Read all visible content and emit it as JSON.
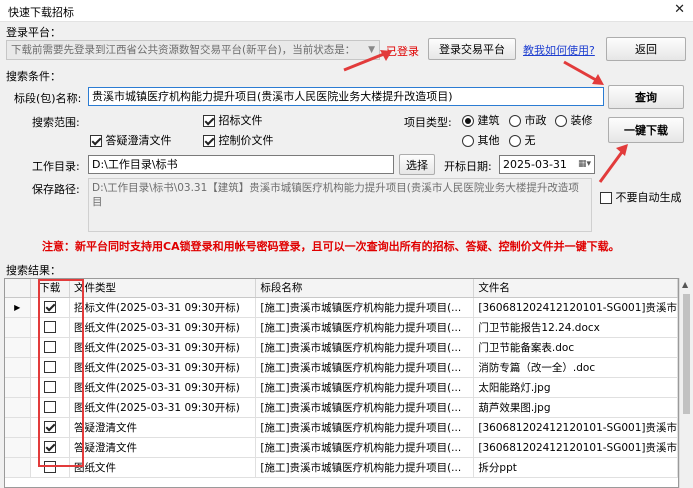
{
  "window": {
    "title": "快速下载招标"
  },
  "login": {
    "section_label": "登录平台：",
    "platform_text": "下载前需要先登录到江西省公共资源数智交易平台(新平台)，当前状态是：",
    "status": "已登录",
    "login_button": "登录交易平台",
    "help_link": "教我如何使用?",
    "back_button": "返回"
  },
  "search": {
    "section_label": "搜索条件：",
    "name_label": "标段(包)名称:",
    "name_value": "贵溪市城镇医疗机构能力提升项目(贵溪市人民医院业务大楼提升改造项目)",
    "query_button": "查询",
    "scope_label": "搜索范围:",
    "scope_options": [
      {
        "label": "招标文件",
        "checked": true
      },
      {
        "label": "答疑澄清文件",
        "checked": true
      },
      {
        "label": "控制价文件",
        "checked": true
      }
    ],
    "type_label": "项目类型:",
    "type_options": [
      {
        "label": "建筑",
        "selected": true
      },
      {
        "label": "市政",
        "selected": false
      },
      {
        "label": "装修",
        "selected": false
      },
      {
        "label": "其他",
        "selected": false
      },
      {
        "label": "无",
        "selected": false
      }
    ],
    "download_button": "一键下载",
    "workdir_label": "工作目录:",
    "workdir_value": "D:\\工作目录\\标书",
    "choose_button": "选择",
    "open_date_label": "开标日期:",
    "open_date_value": "2025-03-31",
    "save_path_label": "保存路径:",
    "save_path_value": "D:\\工作目录\\标书\\03.31【建筑】贵溪市城镇医疗机构能力提升项目(贵溪市人民医院业务大楼提升改造项目",
    "auto_gen_label": "不要自动生成",
    "auto_gen_checked": false
  },
  "note": "注意：新平台同时支持用CA锁登录和用帐号密码登录，且可以一次查询出所有的招标、答疑、控制价文件并一键下载。",
  "results": {
    "section_label": "搜索结果：",
    "columns": [
      "下载",
      "文件类型",
      "标段名称",
      "文件名"
    ],
    "rows": [
      {
        "checked": true,
        "type": "招标文件(2025-03-31 09:30开标)",
        "name": "[施工]贵溪市城镇医疗机构能力提升项目(...",
        "file": "[360681202412120101-SG001]贵溪市"
      },
      {
        "checked": false,
        "type": "图纸文件(2025-03-31 09:30开标)",
        "name": "[施工]贵溪市城镇医疗机构能力提升项目(...",
        "file": "门卫节能报告12.24.docx"
      },
      {
        "checked": false,
        "type": "图纸文件(2025-03-31 09:30开标)",
        "name": "[施工]贵溪市城镇医疗机构能力提升项目(...",
        "file": "门卫节能备案表.doc"
      },
      {
        "checked": false,
        "type": "图纸文件(2025-03-31 09:30开标)",
        "name": "[施工]贵溪市城镇医疗机构能力提升项目(...",
        "file": "消防专篇（改一全）.doc"
      },
      {
        "checked": false,
        "type": "图纸文件(2025-03-31 09:30开标)",
        "name": "[施工]贵溪市城镇医疗机构能力提升项目(...",
        "file": "太阳能路灯.jpg"
      },
      {
        "checked": false,
        "type": "图纸文件(2025-03-31 09:30开标)",
        "name": "[施工]贵溪市城镇医疗机构能力提升项目(...",
        "file": "葫芦效果图.jpg"
      },
      {
        "checked": true,
        "type": "答疑澄清文件",
        "name": "[施工]贵溪市城镇医疗机构能力提升项目(...",
        "file": "[360681202412120101-SG001]贵溪市"
      },
      {
        "checked": true,
        "type": "答疑澄清文件",
        "name": "[施工]贵溪市城镇医疗机构能力提升项目(...",
        "file": "[360681202412120101-SG001]贵溪市"
      },
      {
        "checked": false,
        "type": "图纸文件",
        "name": "[施工]贵溪市城镇医疗机构能力提升项目(...",
        "file": "拆分ppt"
      }
    ]
  },
  "colors": {
    "accent_red": "#e23b3b",
    "note_red": "#e00000",
    "link_blue": "#1f3fd0"
  }
}
